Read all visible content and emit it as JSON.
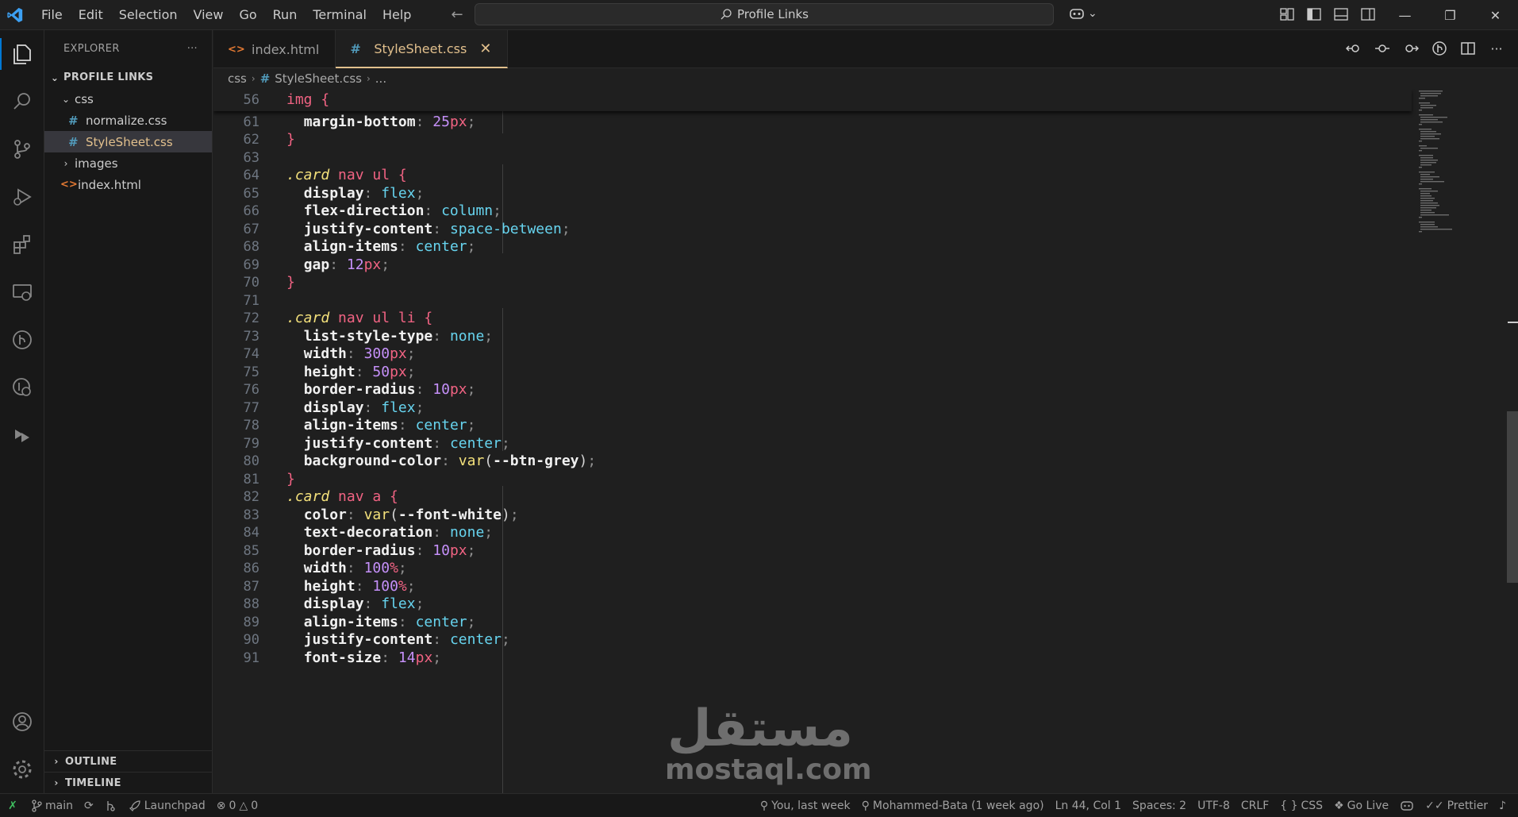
{
  "titlebar": {
    "menu": [
      "File",
      "Edit",
      "Selection",
      "View",
      "Go",
      "Run",
      "Terminal",
      "Help"
    ],
    "search_text": "Profile Links"
  },
  "explorer": {
    "header": "EXPLORER",
    "more": "···",
    "project": "PROFILE LINKS",
    "folder_css": "css",
    "file_normalize": "normalize.css",
    "file_stylesheet": "StyleSheet.css",
    "folder_images": "images",
    "file_index": "index.html",
    "outline": "OUTLINE",
    "timeline": "TIMELINE"
  },
  "tabs": [
    {
      "label": "index.html"
    },
    {
      "label": "StyleSheet.css"
    }
  ],
  "breadcrumb": {
    "folder": "css",
    "file": "StyleSheet.css",
    "rest": "..."
  },
  "code": {
    "sticky": {
      "num": "56",
      "sel": "img",
      "brace": "{"
    },
    "lines": [
      {
        "n": "61"
      },
      {
        "n": "62"
      },
      {
        "n": "63"
      },
      {
        "n": "64"
      },
      {
        "n": "65"
      },
      {
        "n": "66"
      },
      {
        "n": "67"
      },
      {
        "n": "68"
      },
      {
        "n": "69"
      },
      {
        "n": "70"
      },
      {
        "n": "71"
      },
      {
        "n": "72"
      },
      {
        "n": "73"
      },
      {
        "n": "74"
      },
      {
        "n": "75"
      },
      {
        "n": "76"
      },
      {
        "n": "77"
      },
      {
        "n": "78"
      },
      {
        "n": "79"
      },
      {
        "n": "80"
      },
      {
        "n": "81"
      },
      {
        "n": "82"
      },
      {
        "n": "83"
      },
      {
        "n": "84"
      },
      {
        "n": "85"
      },
      {
        "n": "86"
      },
      {
        "n": "87"
      },
      {
        "n": "88"
      },
      {
        "n": "89"
      },
      {
        "n": "90"
      },
      {
        "n": "91"
      }
    ],
    "t": {
      "margin_bottom": "margin-bottom",
      "v25": "25",
      "px": "px",
      "card": ".card",
      "nav_ul": " nav ul ",
      "nav_ul_li": " nav ul li ",
      "nav_a": " nav a ",
      "open": "{",
      "close": "}",
      "display": "display",
      "flex": "flex",
      "flex_direction": "flex-direction",
      "column": "column",
      "justify_content": "justify-content",
      "space_between": "space-between",
      "align_items": "align-items",
      "center": "center",
      "gap": "gap",
      "v12": "12",
      "list_style_type": "list-style-type",
      "none": "none",
      "width": "width",
      "v300": "300",
      "height": "height",
      "v50": "50",
      "border_radius": "border-radius",
      "v10": "10",
      "background_color": "background-color",
      "var": "var",
      "btn_grey": "--btn-grey",
      "color": "color",
      "font_white": "--font-white",
      "text_decoration": "text-decoration",
      "v100": "100",
      "pct": "%",
      "font_size": "font-size",
      "v14": "14",
      "colon": ": ",
      "semi": ";",
      "lp": "(",
      "rp": ")"
    }
  },
  "watermark": {
    "arabic": "مستقل",
    "latin": "mostaql.com"
  },
  "statusbar": {
    "branch": "main",
    "launchpad": "Launchpad",
    "errors": "0",
    "warnings": "0",
    "blame": "You, last week",
    "author": "Mohammed-Bata (1 week ago)",
    "position": "Ln 44, Col 1",
    "spaces": "Spaces: 2",
    "encoding": "UTF-8",
    "eol": "CRLF",
    "language": "CSS",
    "golive": "Go Live",
    "prettier": "Prettier"
  },
  "colors": {
    "accent": "#0078d4",
    "modified_file": "#e2c08d",
    "css_icon": "#519aba",
    "html_icon": "#e37933",
    "selector": "#f16383",
    "value": "#67d4ef",
    "number": "#c590f9"
  }
}
